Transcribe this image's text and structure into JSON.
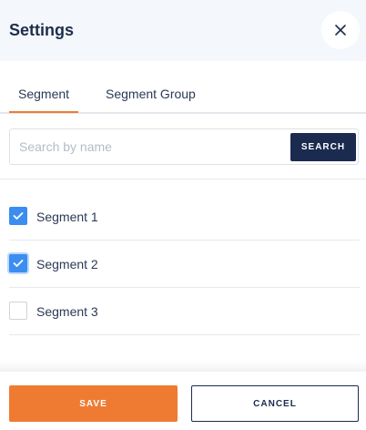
{
  "header": {
    "title": "Settings",
    "close_icon": "close-icon"
  },
  "tabs": [
    {
      "label": "Segment",
      "active": true
    },
    {
      "label": "Segment Group",
      "active": false
    }
  ],
  "search": {
    "placeholder": "Search by name",
    "value": "",
    "button_label": "SEARCH"
  },
  "segments": [
    {
      "label": "Segment 1",
      "checked": true
    },
    {
      "label": "Segment 2",
      "checked": true
    },
    {
      "label": "Segment 3",
      "checked": false
    }
  ],
  "footer": {
    "save_label": "SAVE",
    "cancel_label": "CANCEL"
  },
  "colors": {
    "accent": "#ef7b33",
    "primary": "#1b2a4f",
    "checkbox_checked": "#3b8ef0",
    "header_bg": "#f4f8fc"
  }
}
